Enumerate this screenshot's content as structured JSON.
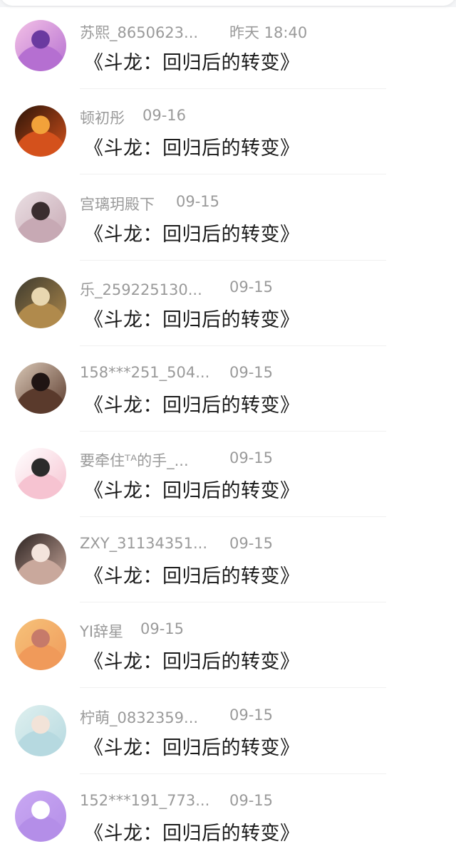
{
  "comments": [
    {
      "name": "苏熙_8650623...",
      "time": "昨天 18:40",
      "title": "《斗龙：回归后的转变》",
      "avatar_colors": [
        "#f3c1e6",
        "#b56fd1",
        "#6a3aa0"
      ],
      "avatar_icon": "anime-girl-pink-avatar"
    },
    {
      "name": "顿初彤",
      "time": "09-16",
      "title": "《斗龙：回归后的转变》",
      "avatar_colors": [
        "#2a1408",
        "#d4511c",
        "#f2a23a"
      ],
      "avatar_icon": "maple-leaves-avatar"
    },
    {
      "name": "宫璃玥殿下",
      "time": "09-15",
      "title": "《斗龙：回归后的转变》",
      "avatar_colors": [
        "#eadfe3",
        "#c7a9b4",
        "#3a2d2f"
      ],
      "avatar_icon": "anime-boy-avatar"
    },
    {
      "name": "乐_259225130...",
      "time": "09-15",
      "title": "《斗龙：回归后的转变》",
      "avatar_colors": [
        "#3d3a2e",
        "#b08a4c",
        "#e8d7b0"
      ],
      "avatar_icon": "lion-avatar"
    },
    {
      "name": "158***251_504...",
      "time": "09-15",
      "title": "《斗龙：回归后的转变》",
      "avatar_colors": [
        "#d9c7b6",
        "#5a3a2c",
        "#1f1413"
      ],
      "avatar_icon": "girl-black-hair-avatar"
    },
    {
      "name": "要牵住ᵀᴬ的手_...",
      "time": "09-15",
      "title": "《斗龙：回归后的转变》",
      "avatar_colors": [
        "#ffffff",
        "#f6c3d1",
        "#2b2b2b"
      ],
      "avatar_icon": "cartoon-bunny-girl-avatar"
    },
    {
      "name": "ZXY_31134351...",
      "time": "09-15",
      "title": "《斗龙：回归后的转变》",
      "avatar_colors": [
        "#2b2220",
        "#c9a89c",
        "#f3e4dc"
      ],
      "avatar_icon": "portrait-girl-avatar"
    },
    {
      "name": "YI辞星",
      "time": "09-15",
      "title": "《斗龙：回归后的转变》",
      "avatar_colors": [
        "#f6c27a",
        "#f09a5a",
        "#c67a6a"
      ],
      "avatar_icon": "sunset-girl-avatar"
    },
    {
      "name": "柠萌_0832359...",
      "time": "09-15",
      "title": "《斗龙：回归后的转变》",
      "avatar_colors": [
        "#dff0ef",
        "#b6d9e0",
        "#f2e3d8"
      ],
      "avatar_icon": "flower-crown-girl-avatar"
    },
    {
      "name": "152***191_773...",
      "time": "09-15",
      "title": "《斗龙：回归后的转变》",
      "avatar_colors": [
        "#c9a8f2",
        "#b48ee8",
        "#ffffff"
      ],
      "avatar_icon": "chat-bubble-avatar"
    }
  ]
}
